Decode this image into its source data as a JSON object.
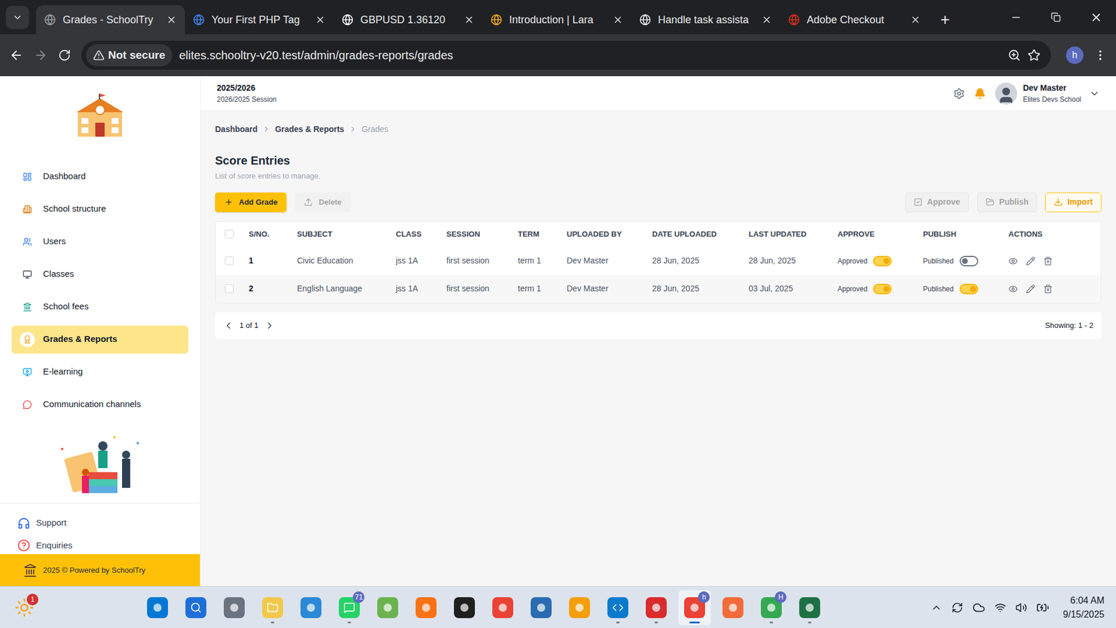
{
  "browser": {
    "tabs": [
      {
        "title": "Grades - SchoolTry",
        "selected": true
      },
      {
        "title": "Your First PHP Tag",
        "selected": false
      },
      {
        "title": "GBPUSD 1.36120",
        "selected": false
      },
      {
        "title": "Introduction | Lara",
        "selected": false
      },
      {
        "title": "Handle task assista",
        "selected": false
      },
      {
        "title": "Adobe Checkout",
        "selected": false
      }
    ],
    "new_tab": "+",
    "security": "Not secure",
    "url": "elites.schooltry-v20.test/admin/grades-reports/grades",
    "profile": "h"
  },
  "header": {
    "session_year": "2025/2026",
    "session_label": "2026/2025 Session",
    "user_name": "Dev Master",
    "school": "Elites Devs School"
  },
  "sidebar": {
    "items": [
      {
        "label": "Dashboard",
        "selected": false
      },
      {
        "label": "School structure",
        "selected": false
      },
      {
        "label": "Users",
        "selected": false
      },
      {
        "label": "Classes",
        "selected": false
      },
      {
        "label": "School fees",
        "selected": false
      },
      {
        "label": "Grades & Reports",
        "selected": true
      },
      {
        "label": "E-learning",
        "selected": false
      },
      {
        "label": "Communication channels",
        "selected": false
      }
    ],
    "bottom": [
      "Support",
      "Enquiries"
    ],
    "footer": "2025 © Powered by SchoolTry"
  },
  "breadcrumbs": [
    "Dashboard",
    "Grades & Reports",
    "Grades"
  ],
  "page": {
    "title": "Score Entries",
    "subtitle": "List of score entries to manage."
  },
  "toolbar": {
    "left": [
      {
        "label": "Add Grade",
        "disabled": false
      },
      {
        "label": "Delete",
        "disabled": true
      }
    ],
    "right": [
      {
        "label": "Approve",
        "disabled": true
      },
      {
        "label": "Publish",
        "disabled": true
      },
      {
        "label": "Import",
        "disabled": false
      }
    ]
  },
  "table": {
    "select_all": false,
    "columns": [
      "S/NO.",
      "SUBJECT",
      "CLASS",
      "SESSION",
      "TERM",
      "UPLOADED BY",
      "DATE UPLOADED",
      "LAST UPDATED",
      "APPROVE",
      "PUBLISH",
      "ACTIONS"
    ],
    "rows": [
      {
        "checked": false,
        "sn": "1",
        "subject": "Civic Education",
        "class": "jss 1A",
        "session": "first session",
        "term": "term 1",
        "uploaded_by": "Dev Master",
        "date_uploaded": "28 Jun, 2025",
        "last_updated": "28 Jun, 2025",
        "approve_label": "Approved",
        "approved": true,
        "publish_label": "Published",
        "published": false
      },
      {
        "checked": false,
        "sn": "2",
        "subject": "English Language",
        "class": "jss 1A",
        "session": "first session",
        "term": "term 1",
        "uploaded_by": "Dev Master",
        "date_uploaded": "28 Jun, 2025",
        "last_updated": "03 Jul, 2025",
        "approve_label": "Approved",
        "approved": true,
        "publish_label": "Published",
        "published": true
      }
    ]
  },
  "pagination": {
    "page": "1 of 1",
    "showing": "Showing: 1 - 2"
  },
  "taskbar": {
    "weather_badge": "1",
    "apps": [
      {
        "badge": "",
        "running": false,
        "active": false
      },
      {
        "badge": "",
        "running": false,
        "active": false
      },
      {
        "badge": "",
        "running": false,
        "active": false
      },
      {
        "badge": "",
        "running": true,
        "active": false
      },
      {
        "badge": "",
        "running": false,
        "active": false
      },
      {
        "badge": "71",
        "running": true,
        "active": false
      },
      {
        "badge": "",
        "running": false,
        "active": false
      },
      {
        "badge": "",
        "running": false,
        "active": false
      },
      {
        "badge": "",
        "running": false,
        "active": false
      },
      {
        "badge": "",
        "running": false,
        "active": false
      },
      {
        "badge": "",
        "running": false,
        "active": false
      },
      {
        "badge": "",
        "running": false,
        "active": false
      },
      {
        "badge": "",
        "running": true,
        "active": false
      },
      {
        "badge": "",
        "running": true,
        "active": false
      },
      {
        "badge": "h",
        "running": true,
        "active": true
      },
      {
        "badge": "",
        "running": false,
        "active": false
      },
      {
        "badge": "H",
        "running": true,
        "active": false
      },
      {
        "badge": "",
        "running": true,
        "active": false
      }
    ],
    "time": "6:04 AM",
    "date": "9/15/2025"
  }
}
